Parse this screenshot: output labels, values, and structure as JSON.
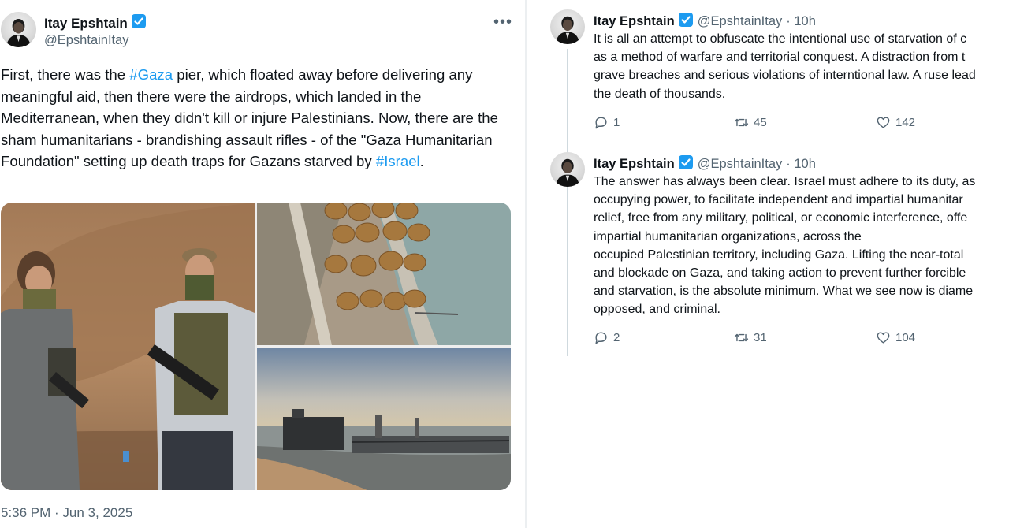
{
  "main_tweet": {
    "author_name": "Itay Epshtain",
    "author_handle": "@EpshtainItay",
    "text_parts": [
      {
        "t": "First, there was the ",
        "tag": false
      },
      {
        "t": "#Gaza",
        "tag": true
      },
      {
        "t": " pier, which floated away before delivering any meaningful aid, then there were the airdrops, which landed in the Mediterranean, when they didn't kill or injure Palestinians. Now, there are the sham humanitarians - brandishing assault rifles - of the \"Gaza Humanitarian Foundation\" setting up death traps for Gazans starved by ",
        "tag": false
      },
      {
        "t": "#Israel",
        "tag": true
      },
      {
        "t": ".",
        "tag": false
      }
    ],
    "timestamp": "5:36 PM · Jun 3, 2025"
  },
  "replies": [
    {
      "author_name": "Itay Epshtain",
      "author_handle": "@EpshtainItay",
      "time": "· 10h",
      "lines": [
        "It is all an attempt to obfuscate the intentional use of starvation of c",
        "as a method of warfare and territorial conquest. A distraction from t",
        "grave breaches and serious violations of interntional law. A ruse lead",
        "the death of thousands."
      ],
      "replies_count": "1",
      "reposts_count": "45",
      "likes_count": "142"
    },
    {
      "author_name": "Itay Epshtain",
      "author_handle": "@EpshtainItay",
      "time": "· 10h",
      "lines": [
        "The answer has always been clear. Israel must adhere to its duty, as",
        "occupying power, to facilitate independent and impartial humanitar",
        "relief, free from any military, political, or economic interference, offe",
        "impartial humanitarian organizations, across the",
        "occupied Palestinian territory, including Gaza. Lifting the near-total",
        "and blockade on Gaza, and taking action to prevent further forcible",
        "and starvation, is the absolute minimum. What we see now is diame",
        "opposed, and criminal."
      ],
      "replies_count": "2",
      "reposts_count": "31",
      "likes_count": "104"
    }
  ],
  "icons": {
    "verified": "verified-badge-icon",
    "more": "more-options-icon",
    "reply": "reply-bubble-icon",
    "repost": "repost-icon",
    "like": "heart-icon"
  },
  "colors": {
    "accent": "#1d9bf0",
    "text": "#0f1419",
    "muted": "#536471"
  }
}
